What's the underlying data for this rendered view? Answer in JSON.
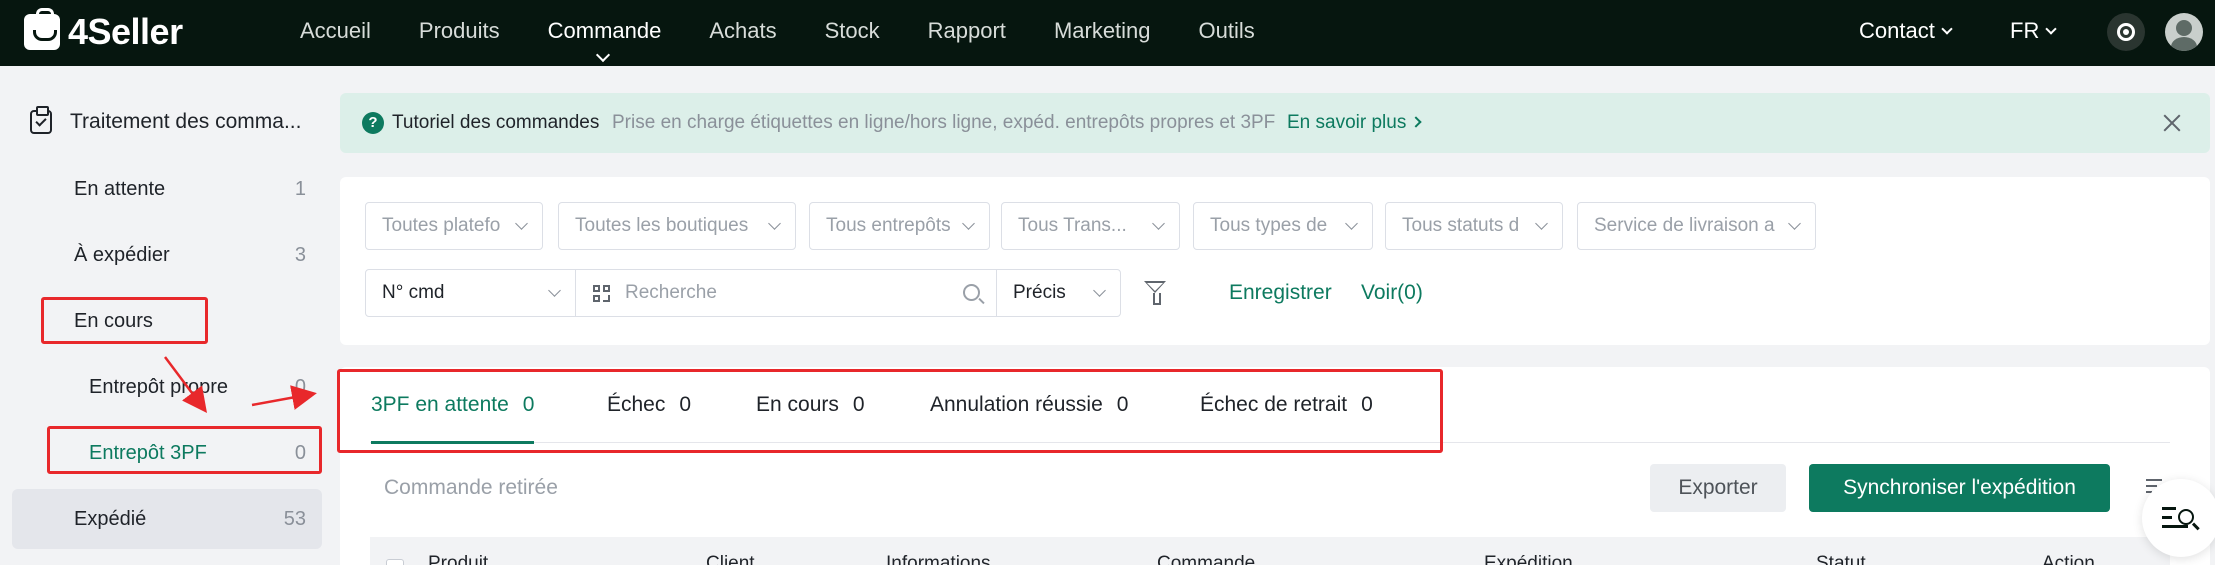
{
  "app": {
    "brand": "4Seller",
    "accent": "#0d7a5f",
    "nav_bg": "#06160f"
  },
  "nav": {
    "items": [
      "Accueil",
      "Produits",
      "Commande",
      "Achats",
      "Stock",
      "Rapport",
      "Marketing",
      "Outils"
    ],
    "active": "Commande",
    "contact": "Contact",
    "lang": "FR",
    "settings_icon": "gear-icon",
    "avatar_icon": "avatar-icon"
  },
  "sidebar": {
    "header": "Traitement des comma...",
    "items": [
      {
        "label": "En attente",
        "count": "1"
      },
      {
        "label": "À expédier",
        "count": "3"
      },
      {
        "label": "En cours",
        "count": ""
      },
      {
        "label": "Entrepôt propre",
        "count": "0"
      },
      {
        "label": "Entrepôt 3PF",
        "count": "0"
      },
      {
        "label": "Expédié",
        "count": "53"
      }
    ]
  },
  "banner": {
    "title": "Tutoriel des commandes",
    "description": "Prise en charge étiquettes en ligne/hors ligne, expéd. entrepôts propres et 3PF",
    "link": "En savoir plus"
  },
  "filters": {
    "dropdowns": [
      "Toutes platefo",
      "Toutes les boutiques",
      "Tous entrepôts",
      "Tous Trans...",
      "Tous types de",
      "Tous statuts d",
      "Service de livraison a"
    ],
    "field_select": "N° cmd",
    "search_placeholder": "Recherche",
    "match_select": "Précis",
    "save_label": "Enregistrer",
    "view_label": "Voir(0)"
  },
  "tabs": [
    {
      "label": "3PF en attente",
      "count": "0"
    },
    {
      "label": "Échec",
      "count": "0"
    },
    {
      "label": "En cours",
      "count": "0"
    },
    {
      "label": "Annulation réussie",
      "count": "0"
    },
    {
      "label": "Échec de retrait",
      "count": "0"
    }
  ],
  "toolbar": {
    "retired": "Commande retirée",
    "export": "Exporter",
    "sync": "Synchroniser l'expédition"
  },
  "table": {
    "headers": [
      "Produit",
      "Client",
      "Informations",
      "Commande",
      "Expédition",
      "Statut",
      "Action"
    ]
  },
  "annotation": {
    "color": "#e8282b"
  }
}
